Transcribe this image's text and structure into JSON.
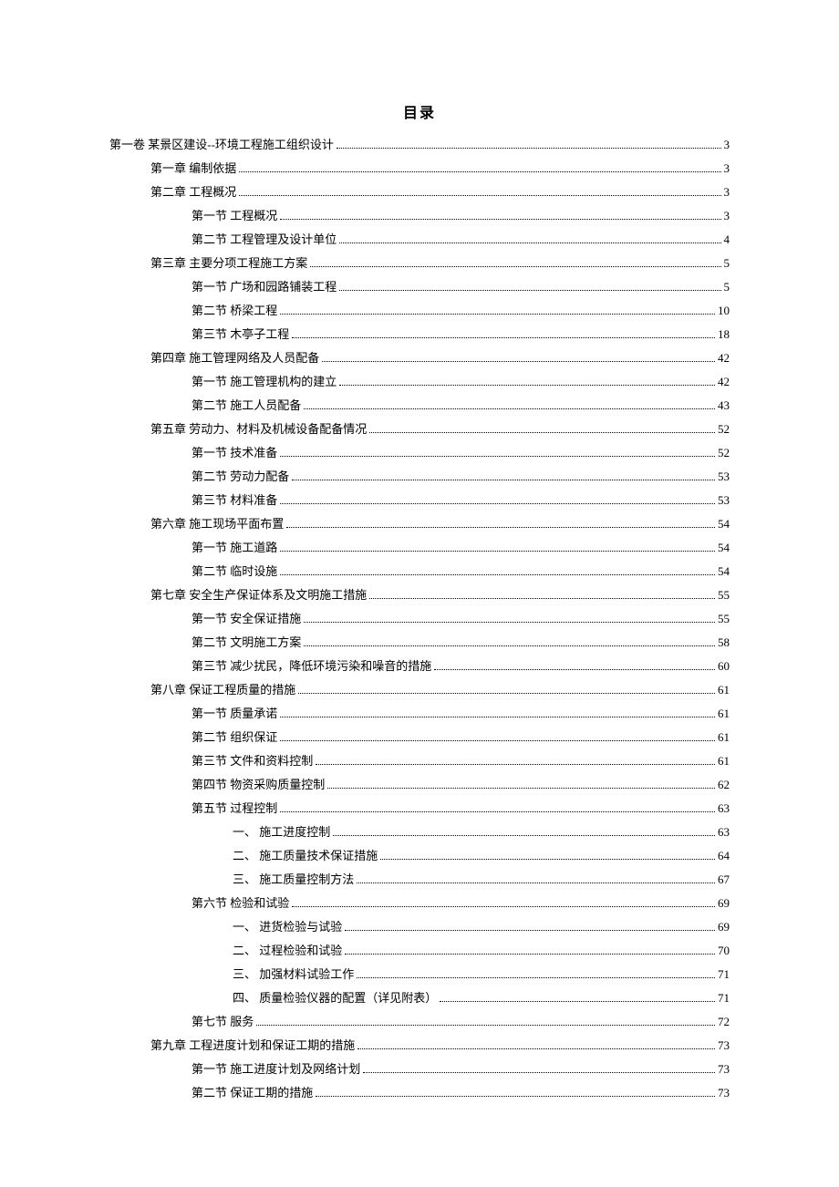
{
  "title": "目录",
  "entries": [
    {
      "level": 0,
      "label": "第一卷 某景区建设--环境工程施工组织设计",
      "page": "3"
    },
    {
      "level": 1,
      "label": "第一章 编制依据",
      "page": "3"
    },
    {
      "level": 1,
      "label": "第二章 工程概况",
      "page": "3"
    },
    {
      "level": 2,
      "label": "第一节 工程概况",
      "page": "3"
    },
    {
      "level": 2,
      "label": "第二节 工程管理及设计单位",
      "page": "4"
    },
    {
      "level": 1,
      "label": "第三章 主要分项工程施工方案",
      "page": "5"
    },
    {
      "level": 2,
      "label": "第一节 广场和园路铺装工程",
      "page": "5"
    },
    {
      "level": 2,
      "label": "第二节 桥梁工程",
      "page": "10"
    },
    {
      "level": 2,
      "label": "第三节 木亭子工程",
      "page": "18"
    },
    {
      "level": 1,
      "label": "第四章 施工管理网络及人员配备",
      "page": "42"
    },
    {
      "level": 2,
      "label": "第一节 施工管理机构的建立",
      "page": "42"
    },
    {
      "level": 2,
      "label": "第二节 施工人员配备",
      "page": "43"
    },
    {
      "level": 1,
      "label": "第五章 劳动力、材料及机械设备配备情况",
      "page": "52"
    },
    {
      "level": 2,
      "label": "第一节 技术准备",
      "page": "52"
    },
    {
      "level": 2,
      "label": "第二节 劳动力配备",
      "page": "53"
    },
    {
      "level": 2,
      "label": "第三节 材料准备",
      "page": "53"
    },
    {
      "level": 1,
      "label": "第六章 施工现场平面布置",
      "page": "54"
    },
    {
      "level": 2,
      "label": "第一节 施工道路",
      "page": "54"
    },
    {
      "level": 2,
      "label": "第二节 临时设施",
      "page": "54"
    },
    {
      "level": 1,
      "label": "第七章 安全生产保证体系及文明施工措施",
      "page": "55"
    },
    {
      "level": 2,
      "label": "第一节 安全保证措施",
      "page": "55"
    },
    {
      "level": 2,
      "label": "第二节 文明施工方案",
      "page": "58"
    },
    {
      "level": 2,
      "label": "第三节 减少扰民，降低环境污染和噪音的措施",
      "page": "60"
    },
    {
      "level": 1,
      "label": "第八章 保证工程质量的措施",
      "page": "61"
    },
    {
      "level": 2,
      "label": "第一节 质量承诺",
      "page": "61"
    },
    {
      "level": 2,
      "label": "第二节 组织保证",
      "page": "61"
    },
    {
      "level": 2,
      "label": "第三节 文件和资料控制",
      "page": "61"
    },
    {
      "level": 2,
      "label": "第四节 物资采购质量控制",
      "page": "62"
    },
    {
      "level": 2,
      "label": "第五节 过程控制",
      "page": "63"
    },
    {
      "level": 3,
      "label": "一、 施工进度控制",
      "page": "63"
    },
    {
      "level": 3,
      "label": "二、 施工质量技术保证措施",
      "page": "64"
    },
    {
      "level": 3,
      "label": "三、 施工质量控制方法",
      "page": "67"
    },
    {
      "level": 2,
      "label": "第六节 检验和试验",
      "page": "69"
    },
    {
      "level": 3,
      "label": "一、 进货检验与试验",
      "page": "69"
    },
    {
      "level": 3,
      "label": "二、 过程检验和试验",
      "page": "70"
    },
    {
      "level": 3,
      "label": "三、 加强材料试验工作",
      "page": "71"
    },
    {
      "level": 3,
      "label": "四、 质量检验仪器的配置（详见附表）",
      "page": "71"
    },
    {
      "level": 2,
      "label": "第七节 服务",
      "page": "72"
    },
    {
      "level": 1,
      "label": "第九章 工程进度计划和保证工期的措施",
      "page": "73"
    },
    {
      "level": 2,
      "label": "第一节 施工进度计划及网络计划",
      "page": "73"
    },
    {
      "level": 2,
      "label": "第二节 保证工期的措施",
      "page": "73"
    }
  ]
}
